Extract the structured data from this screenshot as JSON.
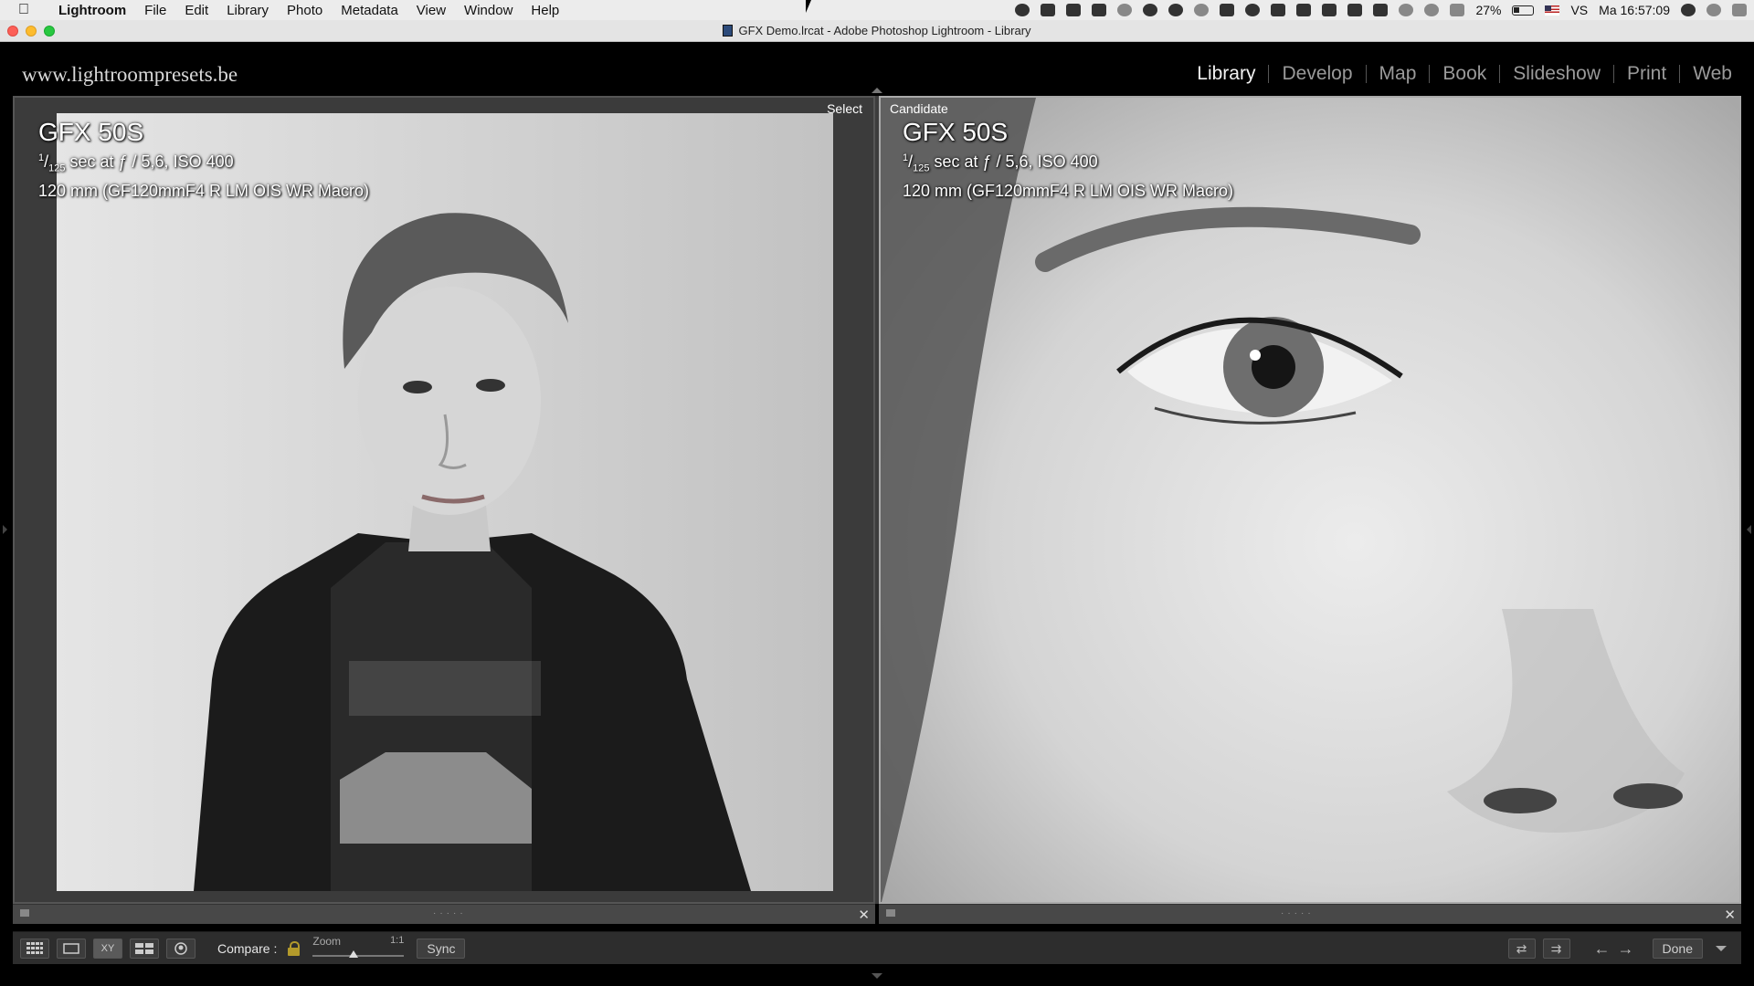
{
  "menubar": {
    "app": "Lightroom",
    "items": [
      "File",
      "Edit",
      "Library",
      "Photo",
      "Metadata",
      "View",
      "Window",
      "Help"
    ],
    "battery": "27%",
    "input_source": "VS",
    "clock": "Ma 16:57:09"
  },
  "window": {
    "title": "GFX Demo.lrcat - Adobe Photoshop Lightroom - Library"
  },
  "identity_plate": "www.lightroompresets.be",
  "modules": {
    "library": "Library",
    "develop": "Develop",
    "map": "Map",
    "book": "Book",
    "slideshow": "Slideshow",
    "print": "Print",
    "web": "Web",
    "active": "library"
  },
  "compare": {
    "select": {
      "label": "Select",
      "camera": "GFX 50S",
      "exp_num": "1",
      "exp_den": "125",
      "exposure_rest": " sec at ƒ / 5,6, ISO 400",
      "lens": "120 mm (GF120mmF4 R LM OIS WR Macro)"
    },
    "candidate": {
      "label": "Candidate",
      "camera": "GFX 50S",
      "exp_num": "1",
      "exp_den": "125",
      "exposure_rest": " sec at ƒ / 5,6, ISO 400",
      "lens": "120 mm (GF120mmF4 R LM OIS WR Macro)"
    }
  },
  "toolbar": {
    "grid_icon": "grid-icon",
    "loupe_icon": "loupe-icon",
    "compare_view_label": "XY",
    "survey_icon": "survey-icon",
    "people_icon": "people-icon",
    "compare_label": "Compare :",
    "zoom_label": "Zoom",
    "zoom_ratio": "1:1",
    "zoom_level": 0.45,
    "sync_label": "Sync",
    "done_label": "Done"
  },
  "colors": {
    "lock": "#b39a2b",
    "candidate_border": "#aaaaaa"
  }
}
